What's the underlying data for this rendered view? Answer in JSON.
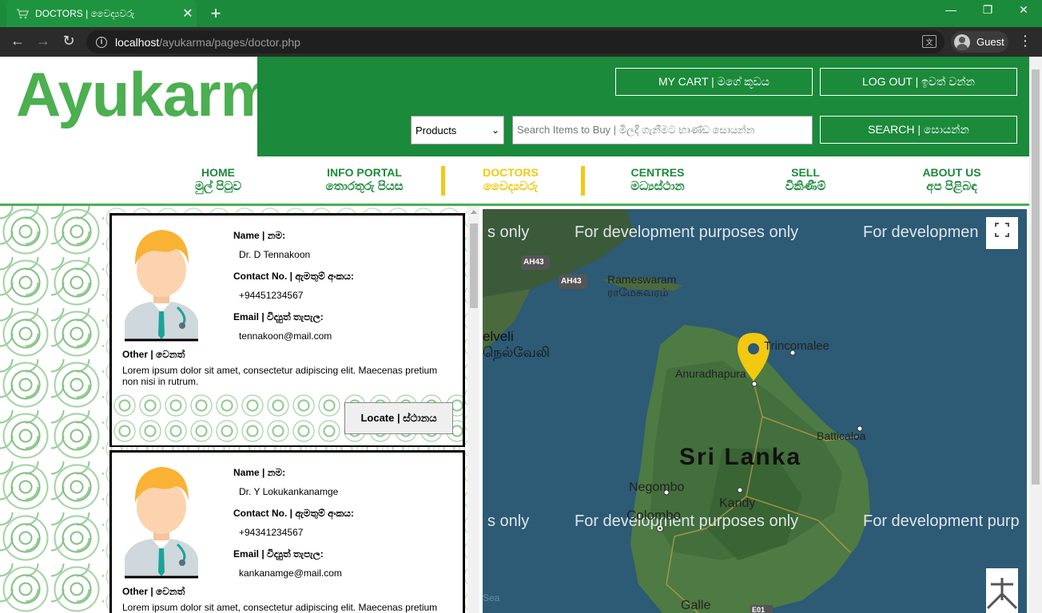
{
  "browser": {
    "tab_title": "DOCTORS | වෛද්‍යවරු",
    "tab_close": "✕",
    "new_tab": "+",
    "url_host": "localhost",
    "url_path": "/ayukarma/pages/doctor.php",
    "profile_name": "Guest",
    "minimize": "—",
    "restore": "❐",
    "close": "✕"
  },
  "header": {
    "logo": "Ayukarma",
    "my_cart": "MY CART  |  මගේ කූඩය",
    "log_out": "LOG OUT  |  ඉවත් වන්න",
    "category_select": "Products",
    "search_placeholder": "Search Items to Buy | මිලදී ගැනීමට භාණ්ඩ සොයන්න",
    "search_button": "SEARCH  |  සොයන්න"
  },
  "nav": [
    {
      "en": "HOME",
      "si": "මුල් පිටුව"
    },
    {
      "en": "INFO PORTAL",
      "si": "තොරතුරු පියස"
    },
    {
      "en": "DOCTORS",
      "si": "වෛද්‍යවරු"
    },
    {
      "en": "CENTRES",
      "si": "මධ්‍යස්ථාන"
    },
    {
      "en": "SELL",
      "si": "විකිණීම්"
    },
    {
      "en": "ABOUT US",
      "si": "අප පිළිබඳ"
    }
  ],
  "labels": {
    "name": "Name | නම:",
    "contact": "Contact No. | ඇමතුම් අංකය:",
    "email": "Email | විද්‍යුත් තැපැල:",
    "other": "Other | වෙනත්",
    "locate": "Locate | ස්ථානය"
  },
  "doctors": [
    {
      "name": "Dr. D Tennakoon",
      "contact": "+94451234567",
      "email": "tennakoon@mail.com",
      "other": "Lorem ipsum dolor sit amet, consectetur adipiscing elit. Maecenas pretium non nisi in rutrum."
    },
    {
      "name": "Dr. Y Lokukankanamge",
      "contact": "+94341234567",
      "email": "kankanamge@mail.com",
      "other": "Lorem ipsum dolor sit amet, consectetur adipiscing elit. Maecenas pretium"
    }
  ],
  "map": {
    "watermark": "For development purposes only",
    "watermark_left": "s only",
    "watermark_right": "For developmen",
    "watermark_right2": "For development purp",
    "country": "Sri Lanka",
    "places": {
      "rameswaram": "Rameswaram",
      "rameswaram_ta": "ராமேசுவரம்",
      "jaffna_part": "elveli",
      "jaffna_ta": "நெல்வேலி",
      "trincomalee": "Trincomalee",
      "anuradhapura": "Anuradhapura",
      "batticaloa": "Batticaloa",
      "negombo": "Negombo",
      "kandy": "Kandy",
      "colombo": "Colombo",
      "galle": "Galle",
      "sea": "Sea"
    },
    "shields": {
      "ah43a": "AH43",
      "ah43b": "AH43",
      "e01": "E01"
    }
  }
}
